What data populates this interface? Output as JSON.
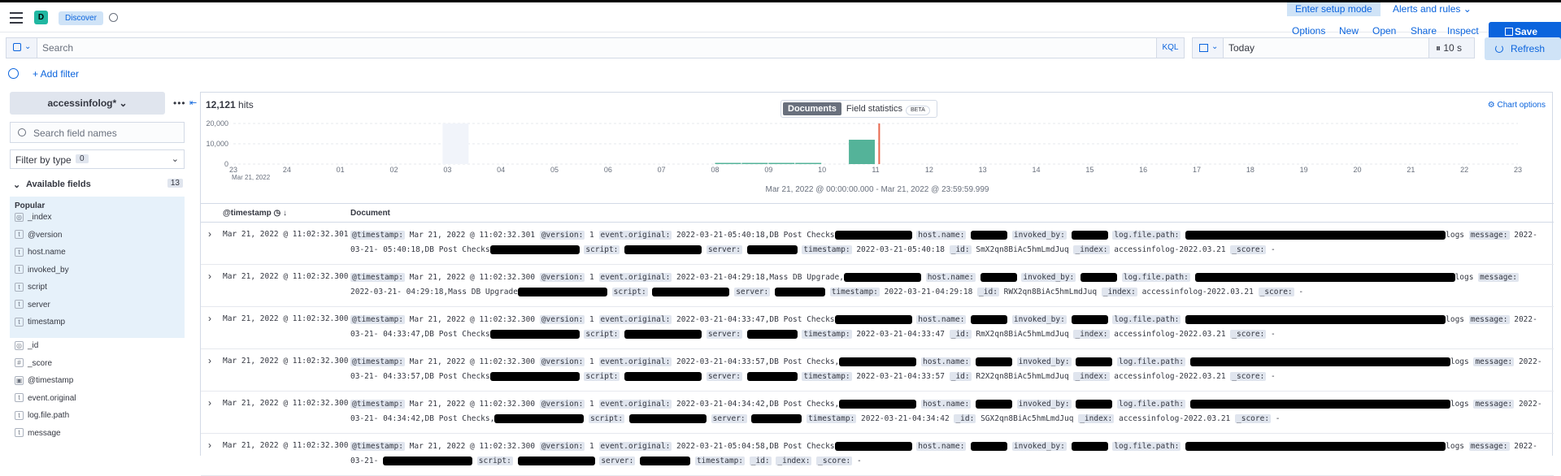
{
  "header": {
    "app_badge": "D",
    "breadcrumb": "Discover",
    "setup_mode": "Enter setup mode",
    "alerts": "Alerts and rules",
    "menu": [
      "Options",
      "New",
      "Open",
      "Share",
      "Inspect"
    ],
    "save": "Save"
  },
  "query": {
    "placeholder": "Search",
    "language": "KQL",
    "date": "Today",
    "refresh_interval": "10 s",
    "refresh": "Refresh",
    "add_filter": "+ Add filter"
  },
  "sidebar": {
    "data_view": "accessinfolog*",
    "search_placeholder": "Search field names",
    "filter_by_type": "Filter by type",
    "filter_count": "0",
    "available_fields": "Available fields",
    "available_count": "13",
    "popular_title": "Popular",
    "popular": [
      {
        "type": "◎",
        "name": "_index"
      },
      {
        "type": "t",
        "name": "@version"
      },
      {
        "type": "t",
        "name": "host.name"
      },
      {
        "type": "t",
        "name": "invoked_by"
      },
      {
        "type": "t",
        "name": "script"
      },
      {
        "type": "t",
        "name": "server"
      },
      {
        "type": "t",
        "name": "timestamp"
      }
    ],
    "other": [
      {
        "type": "◎",
        "name": "_id"
      },
      {
        "type": "#",
        "name": "_score"
      },
      {
        "type": "▣",
        "name": "@timestamp"
      },
      {
        "type": "t",
        "name": "event.original"
      },
      {
        "type": "t",
        "name": "log.file.path"
      },
      {
        "type": "t",
        "name": "message"
      }
    ]
  },
  "main": {
    "hits_count": "12,121",
    "hits_label": "hits",
    "tab_documents": "Documents",
    "tab_field_stats": "Field statistics",
    "beta": "BETA",
    "chart_options": "Chart options",
    "time_range": "Mar 21, 2022 @ 00:00:00.000 - Mar 21, 2022 @ 23:59:59.999",
    "col_timestamp": "@timestamp",
    "col_document": "Document"
  },
  "chart_data": {
    "type": "bar",
    "x_ticks": [
      "23",
      "24",
      "01",
      "02",
      "03",
      "04",
      "05",
      "06",
      "07",
      "08",
      "09",
      "10",
      "11",
      "12",
      "13",
      "14",
      "15",
      "16",
      "17",
      "18",
      "19",
      "20",
      "21",
      "22",
      "23"
    ],
    "x_sublabel": "Mar 21, 2022",
    "y_ticks": [
      "20,000",
      "10,000",
      "0"
    ],
    "ylim": [
      0,
      20000
    ],
    "bars": [
      {
        "hour": "08:00",
        "value": 600
      },
      {
        "hour": "08:30",
        "value": 600
      },
      {
        "hour": "09:00",
        "value": 600
      },
      {
        "hour": "09:30",
        "value": 600
      },
      {
        "hour": "10:30",
        "value": 12000
      }
    ]
  },
  "rows": [
    {
      "ts": "Mar 21, 2022 @ 11:02:32.301",
      "line1": "Mar 21, 2022 @ 11:02:32.301",
      "version": "1",
      "orig": "2022-03-21-05:40:18,DB Post Checks",
      "line2": "05:40:18,DB Post Checks",
      "script": "",
      "stamp": "2022-03-21-05:40:18",
      "id": "SmX2qn8BiAc5hmLmdJuq",
      "index": "accessinfolog-2022.03.21",
      "msg": "2022-03-21-"
    },
    {
      "ts": "Mar 21, 2022 @ 11:02:32.300",
      "line1": "Mar 21, 2022 @ 11:02:32.300",
      "version": "1",
      "orig": "2022-03-21-04:29:18,Mass DB Upgrade,",
      "line2": "04:29:18,Mass DB Upgrade",
      "script": "",
      "stamp": "2022-03-21-04:29:18",
      "id": "RWX2qn8BiAc5hmLmdJuq",
      "index": "accessinfolog-2022.03.21",
      "msg": "2022-03-21-"
    },
    {
      "ts": "Mar 21, 2022 @ 11:02:32.300",
      "line1": "Mar 21, 2022 @ 11:02:32.300",
      "version": "1",
      "orig": "2022-03-21-04:33:47,DB Post Checks",
      "line2": "04:33:47,DB Post Checks",
      "script": "",
      "stamp": "2022-03-21-04:33:47",
      "id": "RmX2qn8BiAc5hmLmdJuq",
      "index": "accessinfolog-2022.03.21",
      "msg": "2022-03-21-"
    },
    {
      "ts": "Mar 21, 2022 @ 11:02:32.300",
      "line1": "Mar 21, 2022 @ 11:02:32.300",
      "version": "1",
      "orig": "2022-03-21-04:33:57,DB Post Checks,",
      "line2": "04:33:57,DB Post Checks",
      "script": "",
      "stamp": "2022-03-21-04:33:57",
      "id": "R2X2qn8BiAc5hmLmdJuq",
      "index": "accessinfolog-2022.03.21",
      "msg": "2022-03-21-"
    },
    {
      "ts": "Mar 21, 2022 @ 11:02:32.300",
      "line1": "Mar 21, 2022 @ 11:02:32.300",
      "version": "1",
      "orig": "2022-03-21-04:34:42,DB Post Checks,",
      "line2": "04:34:42,DB Post Checks,",
      "script": "",
      "stamp": "2022-03-21-04:34:42",
      "id": "SGX2qn8BiAc5hmLmdJuq",
      "index": "accessinfolog-2022.03.21",
      "msg": "2022-03-21-"
    },
    {
      "ts": "Mar 21, 2022 @ 11:02:32.300",
      "line1": "Mar 21, 2022 @ 11:02:32.300",
      "version": "1",
      "orig": "2022-03-21-05:04:58,DB Post Checks",
      "line2": "",
      "script": "",
      "stamp": "",
      "id": "",
      "index": "",
      "msg": "2022-03-21-"
    }
  ]
}
